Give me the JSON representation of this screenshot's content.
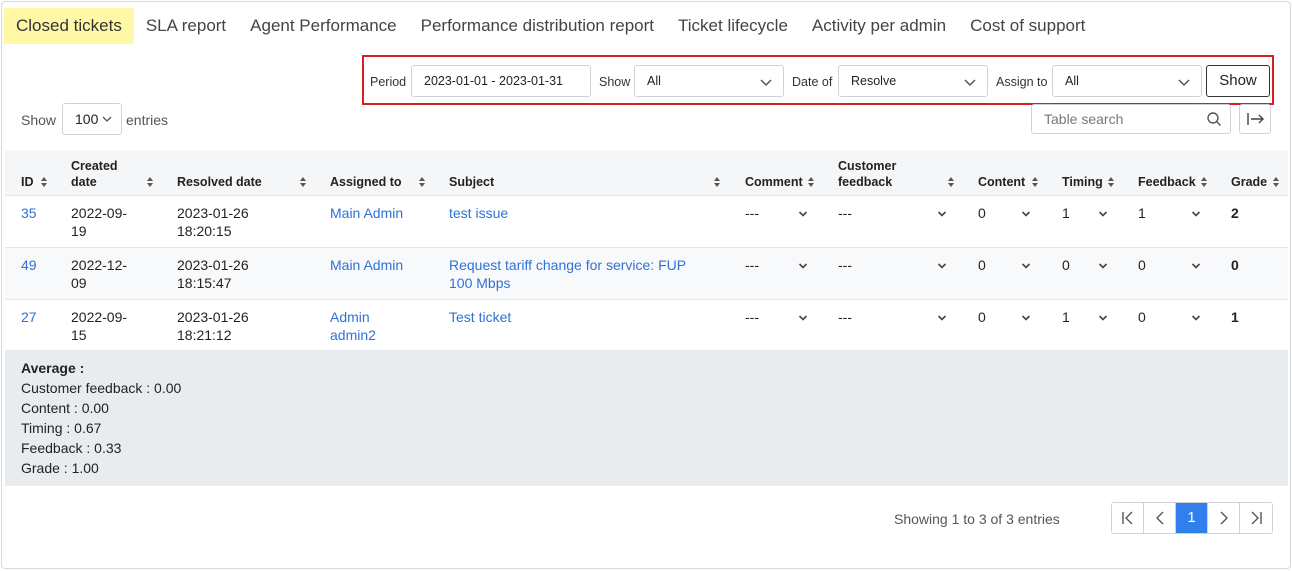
{
  "tabs": [
    {
      "label": "Closed tickets"
    },
    {
      "label": "SLA report"
    },
    {
      "label": "Agent Performance"
    },
    {
      "label": "Performance distribution report"
    },
    {
      "label": "Ticket lifecycle"
    },
    {
      "label": "Activity per admin"
    },
    {
      "label": "Cost of support"
    }
  ],
  "filters": {
    "period_label": "Period",
    "period_value": "2023-01-01 - 2023-01-31",
    "show_label": "Show",
    "show_value": "All",
    "date_of_label": "Date of",
    "date_of_value": "Resolve",
    "assign_to_label": "Assign to",
    "assign_to_value": "All",
    "show_button": "Show"
  },
  "entries": {
    "prefix": "Show",
    "value": "100",
    "suffix": "entries"
  },
  "search": {
    "placeholder": "Table search"
  },
  "table": {
    "headers": {
      "id": "ID",
      "created_1": "Created",
      "created_2": "date",
      "resolved": "Resolved date",
      "assigned": "Assigned to",
      "subject": "Subject",
      "comment": "Comment",
      "cf_1": "Customer",
      "cf_2": "feedback",
      "content": "Content",
      "timing": "Timing",
      "feedback": "Feedback",
      "grade": "Grade"
    },
    "rows": [
      {
        "id": "35",
        "created_1": "2022-09-",
        "created_2": "19",
        "resolved_1": "2023-01-26",
        "resolved_2": "18:20:15",
        "assigned_1": "Main Admin",
        "assigned_2": "",
        "subject_1": "test issue",
        "subject_2": "",
        "comment": "---",
        "customer_feedback": "---",
        "content": "0",
        "timing": "1",
        "feedback": "1",
        "grade": "2"
      },
      {
        "id": "49",
        "created_1": "2022-12-",
        "created_2": "09",
        "resolved_1": "2023-01-26",
        "resolved_2": "18:15:47",
        "assigned_1": "Main Admin",
        "assigned_2": "",
        "subject_1": "Request tariff change for service: FUP",
        "subject_2": "100 Mbps",
        "comment": "---",
        "customer_feedback": "---",
        "content": "0",
        "timing": "0",
        "feedback": "0",
        "grade": "0"
      },
      {
        "id": "27",
        "created_1": "2022-09-",
        "created_2": "15",
        "resolved_1": "2023-01-26",
        "resolved_2": "18:21:12",
        "assigned_1": "Admin",
        "assigned_2": "admin2",
        "subject_1": "Test ticket",
        "subject_2": "",
        "comment": "---",
        "customer_feedback": "---",
        "content": "0",
        "timing": "1",
        "feedback": "0",
        "grade": "1"
      }
    ]
  },
  "average": {
    "title": "Average :",
    "lines": [
      "Customer feedback : 0.00",
      "Content : 0.00",
      "Timing : 0.67",
      "Feedback : 0.33",
      "Grade : 1.00"
    ]
  },
  "pagination": {
    "info": "Showing 1 to 3 of 3 entries",
    "current_page": "1"
  }
}
